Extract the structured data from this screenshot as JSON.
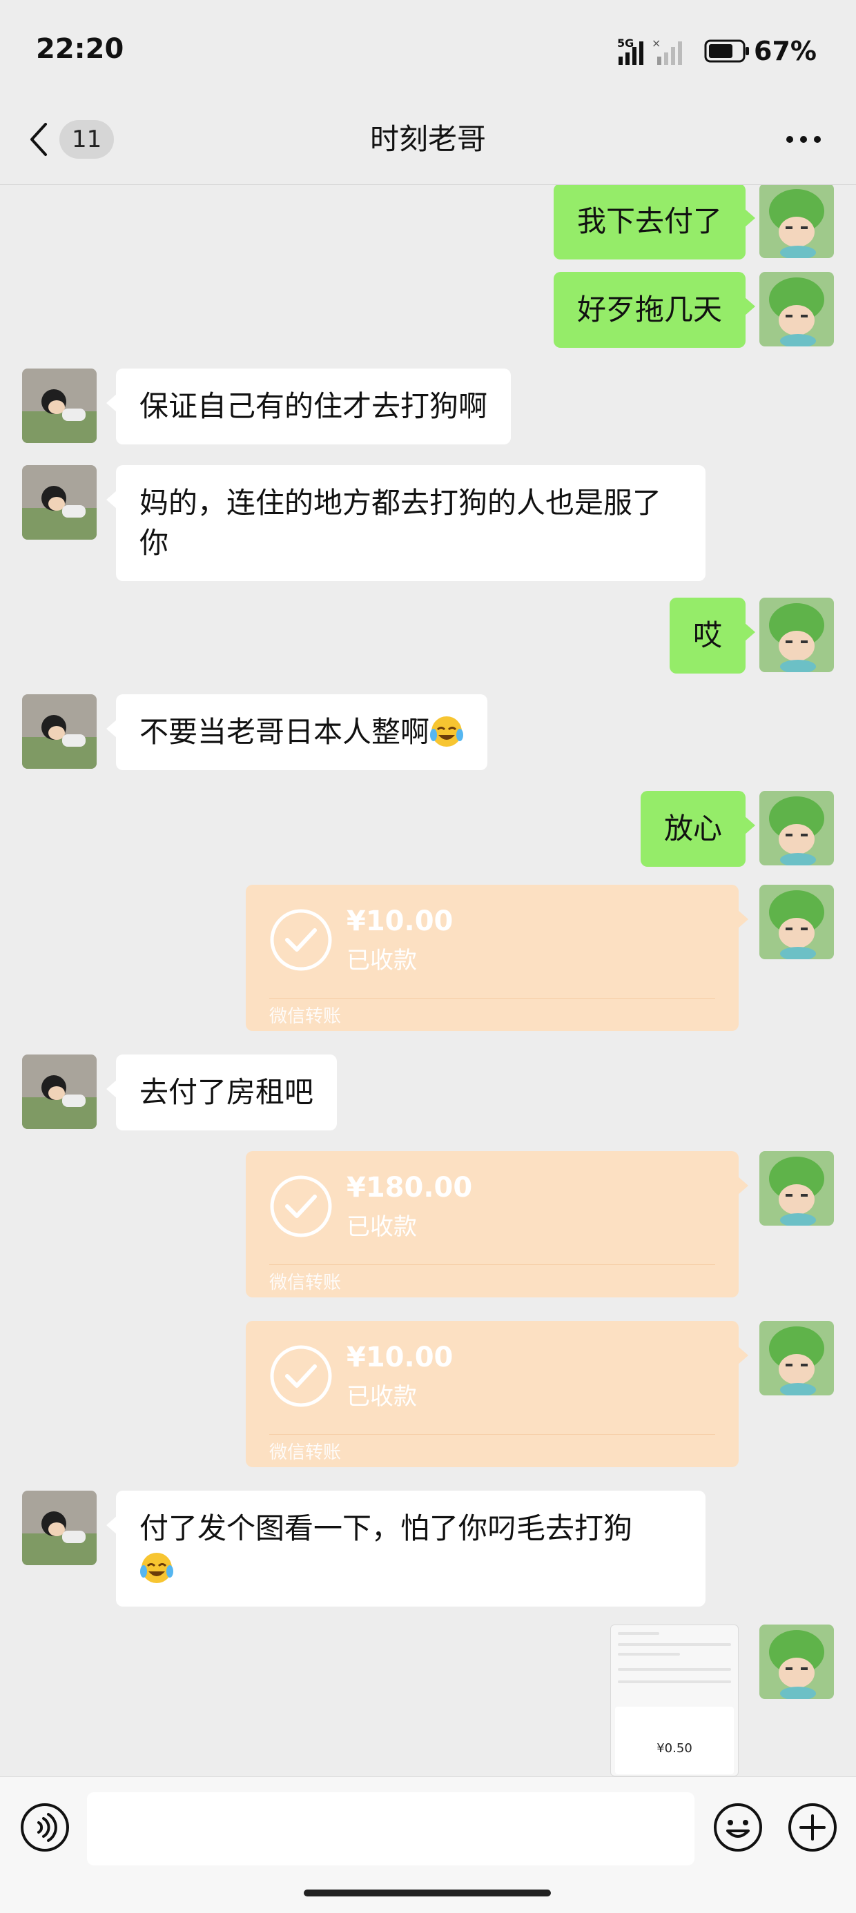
{
  "status_bar": {
    "time": "22:20",
    "network": "5G",
    "battery_percent": "67%"
  },
  "header": {
    "back_badge": "11",
    "title": "时刻老哥",
    "more_icon": "ellipsis-icon"
  },
  "messages": [
    {
      "from": "me",
      "type": "text",
      "text": "我下去付了"
    },
    {
      "from": "me",
      "type": "text",
      "text": "好歹拖几天"
    },
    {
      "from": "other",
      "type": "text",
      "text": "保证自己有的住才去打狗啊"
    },
    {
      "from": "other",
      "type": "text",
      "text": "妈的，连住的地方都去打狗的人也是服了你"
    },
    {
      "from": "me",
      "type": "text",
      "text": "哎"
    },
    {
      "from": "other",
      "type": "text",
      "text": "不要当老哥日本人整啊",
      "emoji": "laugh-cry-emoji"
    },
    {
      "from": "me",
      "type": "text",
      "text": "放心"
    },
    {
      "from": "me",
      "type": "transfer",
      "amount": "¥10.00",
      "status": "已收款",
      "label": "微信转账"
    },
    {
      "from": "other",
      "type": "text",
      "text": "去付了房租吧"
    },
    {
      "from": "me",
      "type": "transfer",
      "amount": "¥180.00",
      "status": "已收款",
      "label": "微信转账"
    },
    {
      "from": "me",
      "type": "transfer",
      "amount": "¥10.00",
      "status": "已收款",
      "label": "微信转账"
    },
    {
      "from": "other",
      "type": "text",
      "text": "付了发个图看一下，怕了你叼毛去打狗",
      "emoji": "laugh-cry-emoji"
    },
    {
      "from": "me",
      "type": "image",
      "thumb_amount": "¥0.50"
    }
  ],
  "input_bar": {
    "voice_icon": "voice-icon",
    "emoji_icon": "smile-icon",
    "plus_icon": "plus-icon",
    "value": ""
  },
  "colors": {
    "background": "#ededed",
    "my_bubble": "#95ec69",
    "their_bubble": "#ffffff",
    "transfer_card": "#fce0c2"
  }
}
